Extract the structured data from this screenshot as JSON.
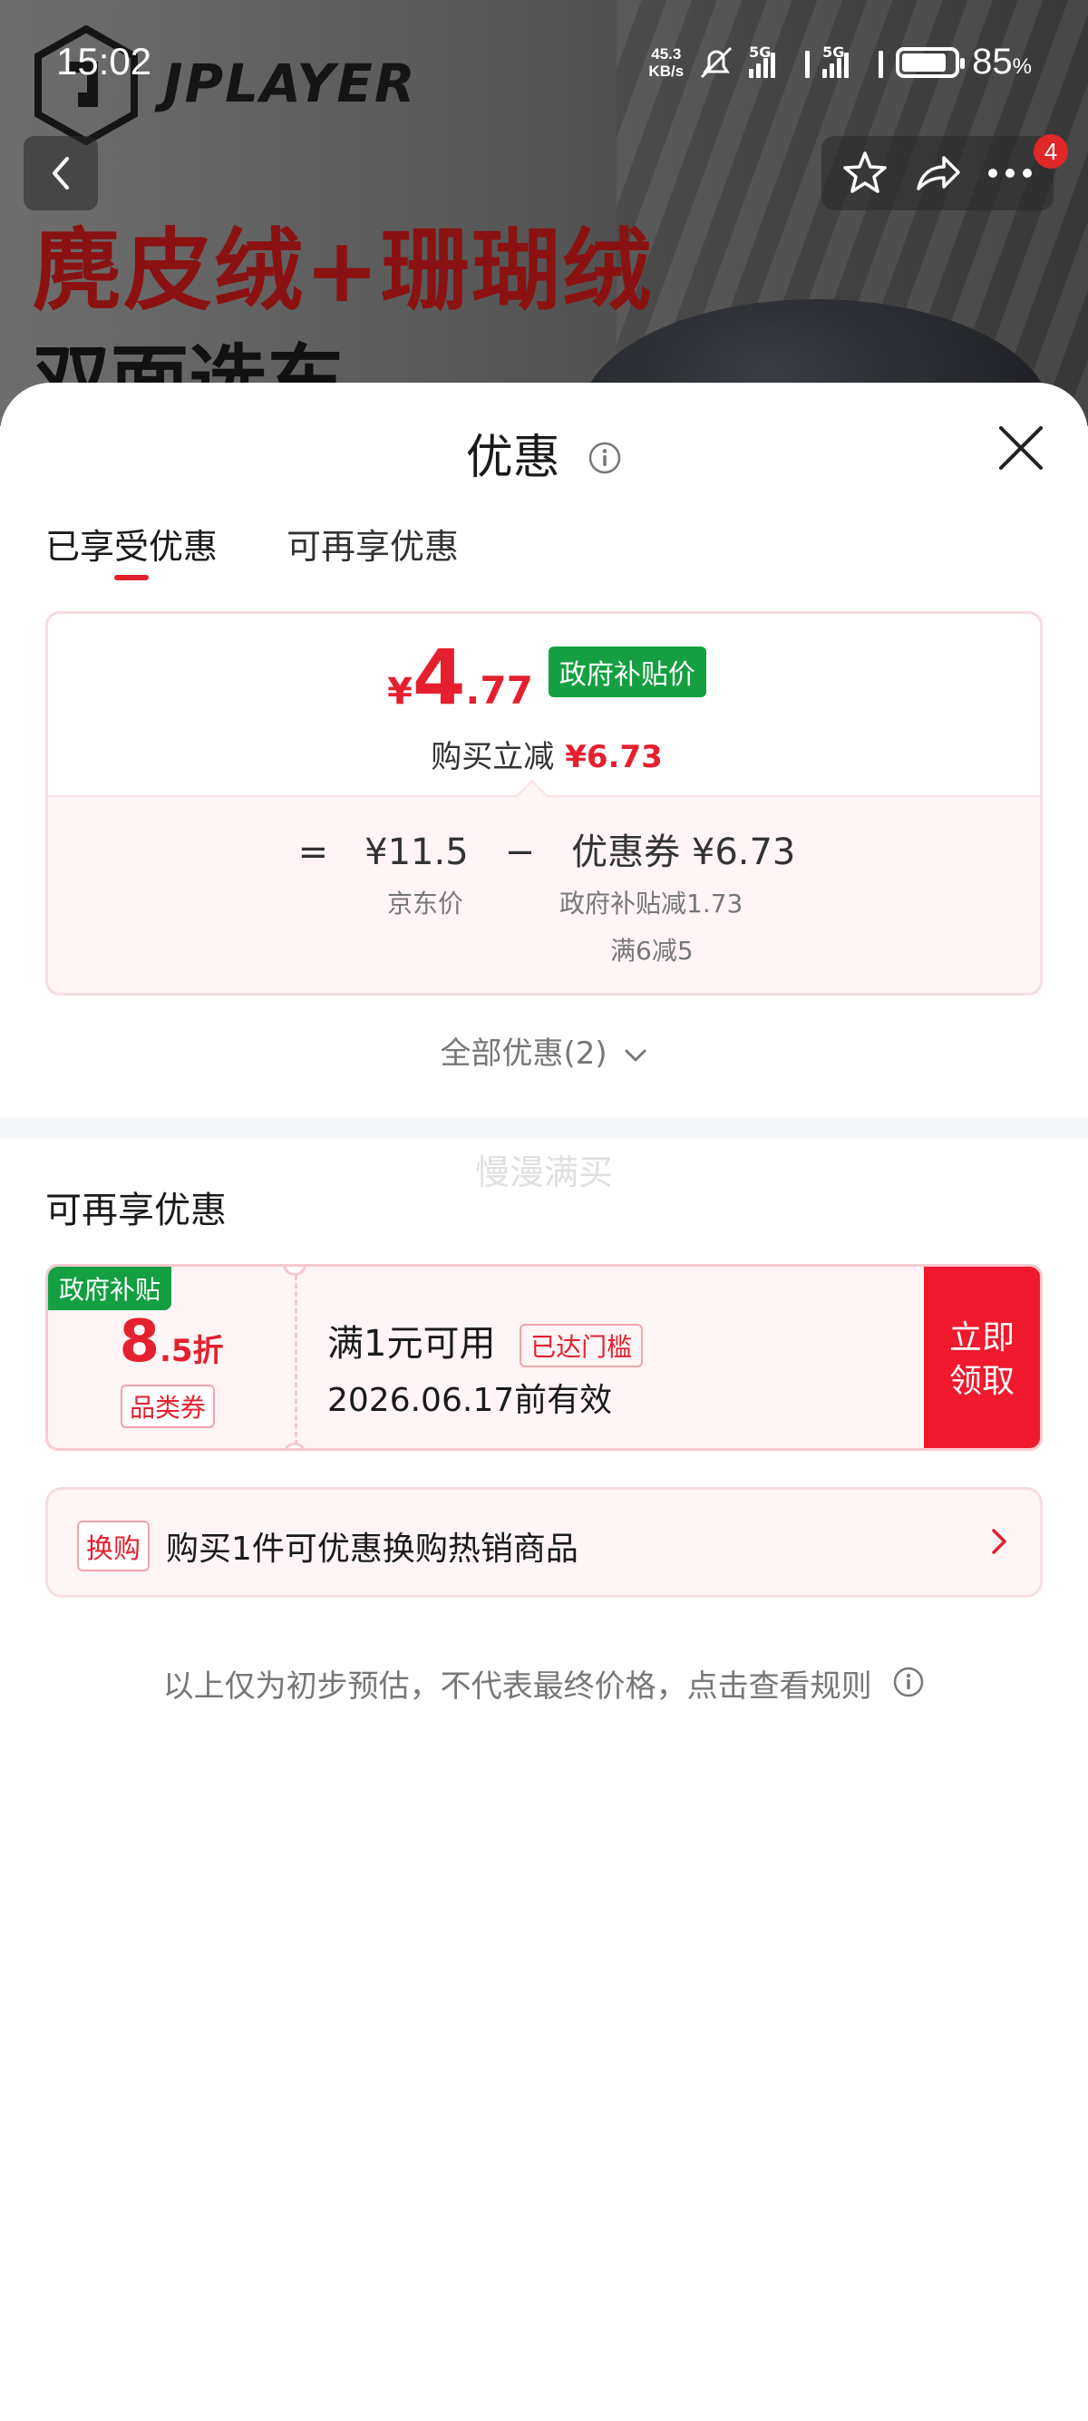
{
  "status_bar": {
    "time": "15:02",
    "net_speed_value": "45.3",
    "net_speed_unit": "KB/s",
    "signal1_label": "5G",
    "signal2_label": "5G",
    "battery_percent": "85",
    "battery_unit": "%"
  },
  "background": {
    "brand_logo_text": "JPLAYER",
    "promo_line1": "麂皮绒+珊瑚绒",
    "promo_line2": "双面选东"
  },
  "nav": {
    "more_badge_count": "4"
  },
  "sheet": {
    "title": "优惠",
    "tabs": [
      {
        "label": "已享受优惠",
        "active": true
      },
      {
        "label": "可再享优惠",
        "active": false
      }
    ],
    "breakdown": {
      "currency_symbol": "¥",
      "final_price_int": "4",
      "final_price_dec": ".77",
      "price_tag": "政府补贴价",
      "instant_saving_label": "购买立减",
      "instant_saving_amount": "¥6.73",
      "equals": "=",
      "jd_price": "¥11.5",
      "minus": "−",
      "coupon_label": "优惠券 ¥6.73",
      "jd_price_label": "京东价",
      "coupon_detail_1": "政府补贴减1.73",
      "coupon_detail_2": "满6减5"
    },
    "all_offers_label": "全部优惠(2)",
    "watermark": "慢漫满买",
    "more_section_title": "可再享优惠",
    "coupon": {
      "tag": "政府补贴",
      "discount_int": "8",
      "discount_dec": ".5折",
      "category": "品类券",
      "condition": "满1元可用",
      "status": "已达门槛",
      "valid_until": "2026.06.17前有效",
      "claim_line1": "立即",
      "claim_line2": "领取"
    },
    "exchange": {
      "tag": "换购",
      "text": "购买1件可优惠换购热销商品"
    },
    "disclaimer": "以上仅为初步预估，不代表最终价格，点击查看规则"
  },
  "colors": {
    "accent_red": "#e4202e",
    "claim_red": "#f0192e",
    "gov_green": "#14a040",
    "card_pink": "#fff5f6"
  }
}
